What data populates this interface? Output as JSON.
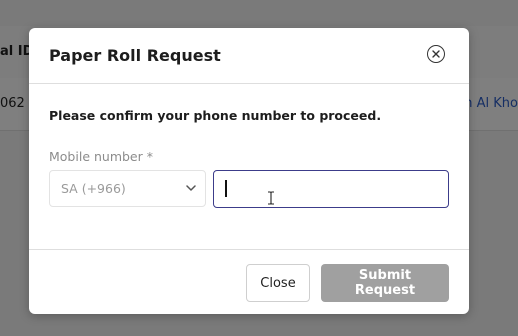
{
  "background": {
    "column_header_partial": "al ID",
    "row_value_partial": "062",
    "row_link_partial": "h Al Kho"
  },
  "modal": {
    "title": "Paper Roll Request",
    "close_icon": "close-circle-icon",
    "confirm_text": "Please confirm your phone number to proceed.",
    "mobile_label": "Mobile number *",
    "country_code_value": "SA (+966)",
    "phone_value": "",
    "close_button_label": "Close",
    "submit_button_label": "Submit Request"
  },
  "colors": {
    "overlay": "#000000",
    "input_focus_border": "#3c3c8a",
    "submit_disabled_bg": "#a0a0a0",
    "link": "#2b5cc8"
  }
}
